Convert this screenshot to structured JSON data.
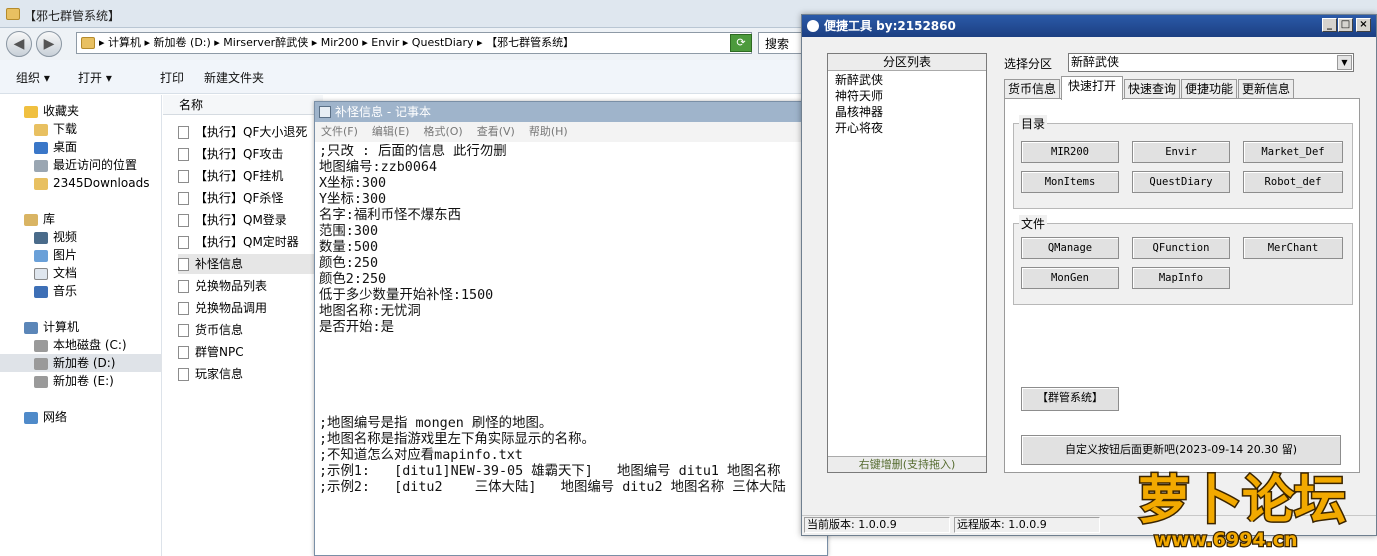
{
  "explorer": {
    "title": "【邪七群管系统】",
    "address": "▸ 计算机 ▸ 新加卷 (D:) ▸ Mirserver醉武侠 ▸ Mir200 ▸ Envir ▸ QuestDiary ▸ 【邪七群管系统】",
    "search_label": "搜索",
    "toolbar": [
      "组织 ▾",
      "打开 ▾",
      "打印",
      "新建文件夹"
    ],
    "column_name": "名称",
    "nav": [
      {
        "label": "收藏夹",
        "icon": "star-icon"
      },
      {
        "label": "下载",
        "icon": "download-folder-icon"
      },
      {
        "label": "桌面",
        "icon": "desktop-icon"
      },
      {
        "label": "最近访问的位置",
        "icon": "recent-places-icon"
      },
      {
        "label": "2345Downloads",
        "icon": "folder-icon"
      },
      {
        "label": "库",
        "icon": "library-icon"
      },
      {
        "label": "视频",
        "icon": "video-icon"
      },
      {
        "label": "图片",
        "icon": "pictures-icon"
      },
      {
        "label": "文档",
        "icon": "documents-icon"
      },
      {
        "label": "音乐",
        "icon": "music-icon"
      },
      {
        "label": "计算机",
        "icon": "computer-icon"
      },
      {
        "label": "本地磁盘 (C:)",
        "icon": "drive-icon"
      },
      {
        "label": "新加卷 (D:)",
        "icon": "drive-icon"
      },
      {
        "label": "新加卷 (E:)",
        "icon": "drive-icon"
      },
      {
        "label": "网络",
        "icon": "network-icon"
      }
    ],
    "files": [
      "【执行】QF大小退死",
      "【执行】QF攻击",
      "【执行】QF挂机",
      "【执行】QF杀怪",
      "【执行】QM登录",
      "【执行】QM定时器",
      "补怪信息",
      "兑换物品列表",
      "兑换物品调用",
      "货币信息",
      "群管NPC",
      "玩家信息"
    ]
  },
  "notepad": {
    "title": "补怪信息 - 记事本",
    "menu": [
      "文件(F)",
      "编辑(E)",
      "格式(O)",
      "查看(V)",
      "帮助(H)"
    ],
    "lines": [
      ";只改 : 后面的信息 此行勿删",
      "地图编号:zzb0064",
      "X坐标:300",
      "Y坐标:300",
      "名字:福利币怪不爆东西",
      "范围:300",
      "数量:500",
      "颜色:250",
      "颜色2:250",
      "低于多少数量开始补怪:1500",
      "地图名称:无忧洞",
      "是否开始:是",
      "",
      "",
      "",
      "",
      "",
      ";地图编号是指 mongen 刷怪的地图。",
      ";地图名称是指游戏里左下角实际显示的名称。",
      ";不知道怎么对应看mapinfo.txt",
      ";示例1:   [ditu1]NEW-39-05 雄霸天下]   地图编号 ditu1 地图名称",
      ";示例2:   [ditu2    三体大陆]   地图编号 ditu2 地图名称 三体大陆"
    ]
  },
  "tool": {
    "title": "便捷工具   by:2152860",
    "partition_header": "分区列表",
    "partitions": [
      "新醉武侠",
      "神符天师",
      "晶核神器",
      "开心将夜"
    ],
    "partition_footer": "右键增删(支持拖入)",
    "select_label": "选择分区",
    "select_value": "新醉武侠",
    "tabs": [
      "货币信息",
      "快速打开",
      "快速查询",
      "便捷功能",
      "更新信息"
    ],
    "group_dir": "目录",
    "dir_buttons": [
      "MIR200",
      "Envir",
      "Market_Def",
      "MonItems",
      "QuestDiary",
      "Robot_def"
    ],
    "group_file": "文件",
    "file_buttons": [
      "QManage",
      "QFunction",
      "MerChant",
      "MonGen",
      "MapInfo"
    ],
    "system_button": "【群管系统】",
    "custom_button": "自定义按钮后面更新吧(2023-09-14 20.30 留)",
    "status_local": "当前版本: 1.0.0.9",
    "status_remote": "远程版本: 1.0.0.9"
  },
  "watermark": {
    "name": "萝卜论坛",
    "url": "www.6994.cn"
  },
  "colors": {
    "tool_title": "#1c3f82",
    "notepad_title": "#9fb4cb",
    "selection": "#dfe3e8"
  }
}
